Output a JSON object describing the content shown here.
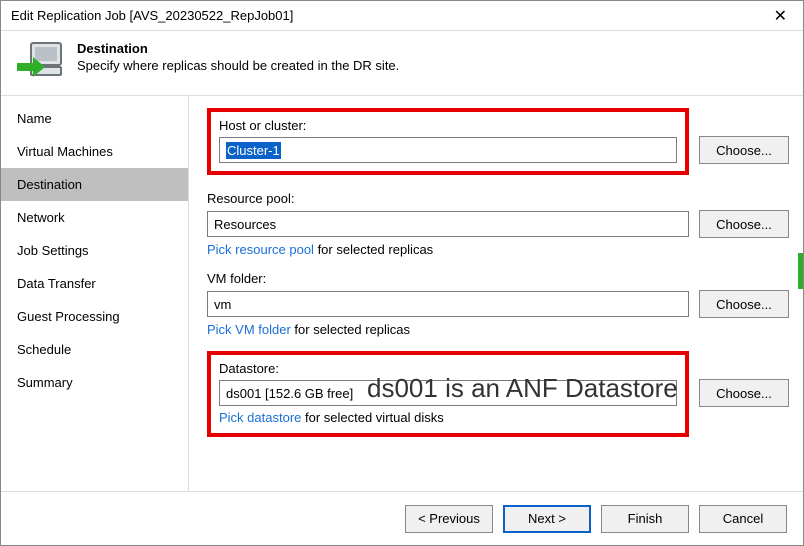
{
  "window": {
    "title": "Edit Replication Job [AVS_20230522_RepJob01]"
  },
  "header": {
    "heading": "Destination",
    "sub": "Specify where replicas should be created in the DR site."
  },
  "sidebar": {
    "items": [
      {
        "label": "Name",
        "active": false
      },
      {
        "label": "Virtual Machines",
        "active": false
      },
      {
        "label": "Destination",
        "active": true
      },
      {
        "label": "Network",
        "active": false
      },
      {
        "label": "Job Settings",
        "active": false
      },
      {
        "label": "Data Transfer",
        "active": false
      },
      {
        "label": "Guest Processing",
        "active": false
      },
      {
        "label": "Schedule",
        "active": false
      },
      {
        "label": "Summary",
        "active": false
      }
    ]
  },
  "fields": {
    "host": {
      "label": "Host or cluster:",
      "value": "Cluster-1",
      "choose": "Choose..."
    },
    "pool": {
      "label": "Resource pool:",
      "value": "Resources",
      "choose": "Choose...",
      "hint_link": "Pick resource pool",
      "hint_rest": "  for selected replicas"
    },
    "folder": {
      "label": "VM folder:",
      "value": "vm",
      "choose": "Choose...",
      "hint_link": "Pick VM folder",
      "hint_rest": "  for selected replicas"
    },
    "datastore": {
      "label": "Datastore:",
      "value": "ds001 [152.6 GB free]",
      "choose": "Choose...",
      "hint_link": "Pick datastore",
      "hint_rest": "  for selected virtual disks"
    }
  },
  "annotation": "ds001 is an ANF Datastore",
  "footer": {
    "previous": "< Previous",
    "next": "Next >",
    "finish": "Finish",
    "cancel": "Cancel"
  }
}
